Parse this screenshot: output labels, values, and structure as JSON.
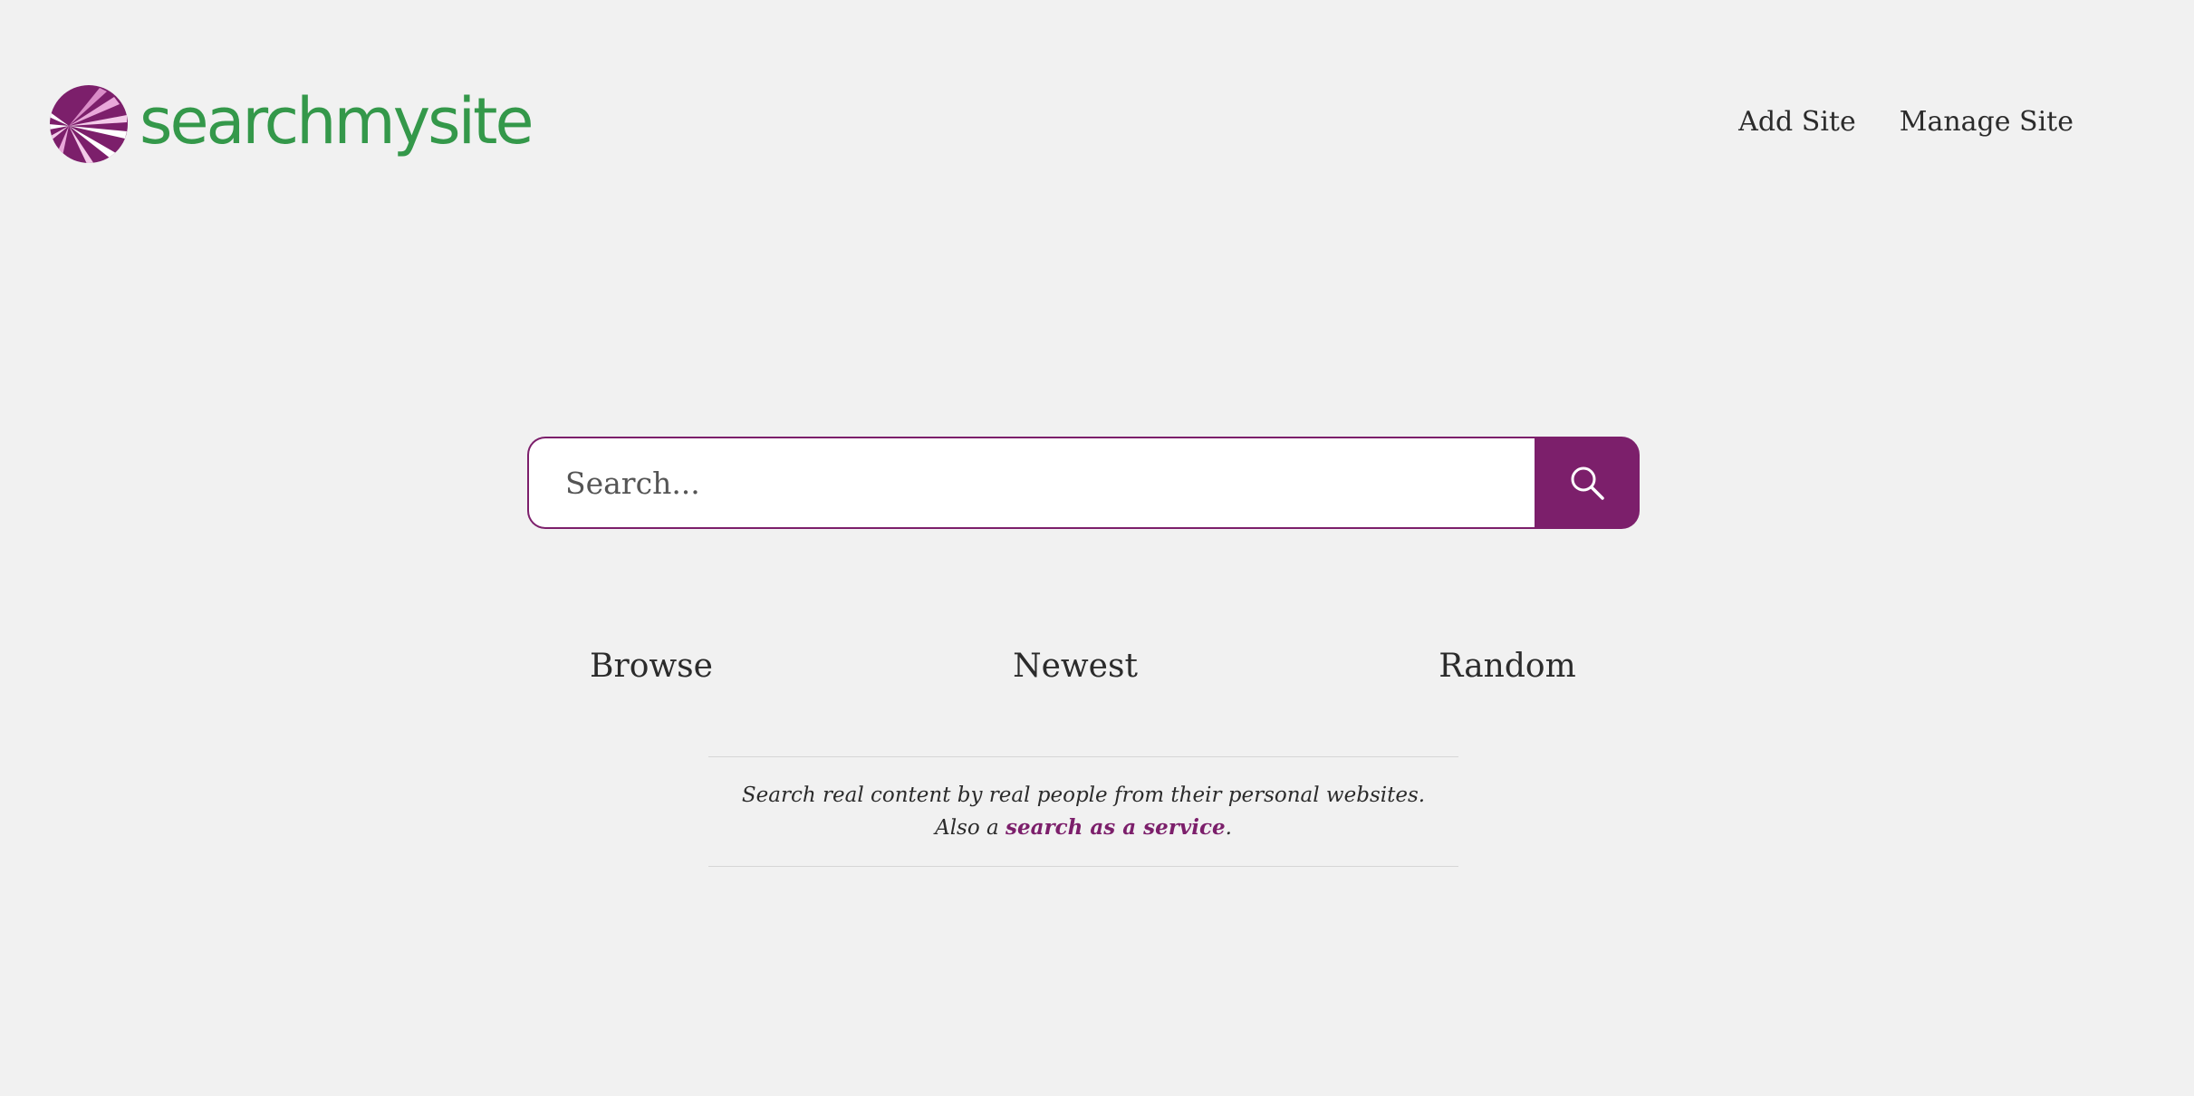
{
  "brand": {
    "name": "searchmysite",
    "text_color": "#34984a",
    "logo_icon": "circle-sunburst-logo"
  },
  "nav": {
    "items": [
      {
        "label": "Add Site"
      },
      {
        "label": "Manage Site"
      }
    ]
  },
  "search": {
    "placeholder": "Search...",
    "value": "",
    "button_icon": "search-icon",
    "accent_color": "#7c1f6b"
  },
  "sections": [
    {
      "label": "Browse"
    },
    {
      "label": "Newest"
    },
    {
      "label": "Random"
    }
  ],
  "tagline": {
    "text": "Search real content by real people from their personal websites. Also a ",
    "link_text": "search as a service",
    "suffix": "."
  },
  "colors": {
    "background": "#f1f1f1",
    "accent": "#7c1f6b",
    "brand_green": "#34984a",
    "text": "#2b2b2b"
  }
}
